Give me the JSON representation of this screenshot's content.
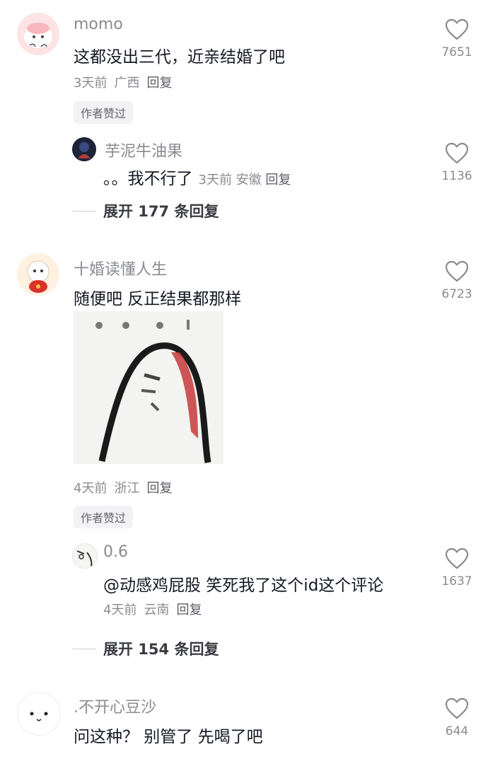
{
  "comments": [
    {
      "user": "momo",
      "text": "这都没出三代，近亲结婚了吧",
      "time": "3天前",
      "location": "广西",
      "reply_label": "回复",
      "badge": "作者赞过",
      "likes": "7651",
      "replies": [
        {
          "user": "芋泥牛油果",
          "text": "。。我不行了",
          "time": "3天前",
          "location": "安徽",
          "reply_label": "回复",
          "likes": "1136"
        }
      ],
      "expand_label": "展开 177 条回复"
    },
    {
      "user": "十婚读懂人生",
      "text": "随便吧 反正结果都那样",
      "time": "4天前",
      "location": "浙江",
      "reply_label": "回复",
      "badge": "作者赞过",
      "likes": "6723",
      "replies": [
        {
          "user": "0.6",
          "text": "@动感鸡屁股  笑死我了这个id这个评论",
          "time": "4天前",
          "location": "云南",
          "reply_label": "回复",
          "likes": "1637"
        }
      ],
      "expand_label": "展开 154 条回复"
    },
    {
      "user": ".不开心豆沙",
      "text": "问这种？ 别管了 先喝了吧",
      "likes": "644"
    }
  ],
  "icons": {
    "like": "heart-outline-icon"
  },
  "colors": {
    "username": "#8a8b91",
    "text": "#161823",
    "meta": "#8a8b91",
    "badge_bg": "#f2f2f4"
  }
}
